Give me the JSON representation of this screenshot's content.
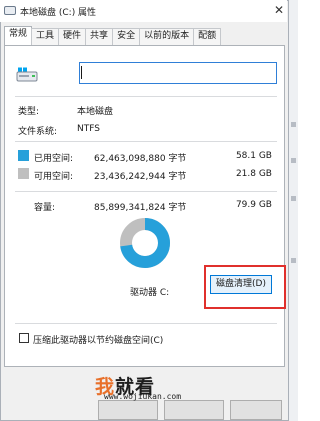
{
  "window": {
    "title": "本地磁盘 (C:) 属性",
    "close_glyph": "✕"
  },
  "tabs": [
    {
      "label": "常规",
      "active": true
    },
    {
      "label": "工具",
      "active": false
    },
    {
      "label": "硬件",
      "active": false
    },
    {
      "label": "共享",
      "active": false
    },
    {
      "label": "安全",
      "active": false
    },
    {
      "label": "以前的版本",
      "active": false
    },
    {
      "label": "配额",
      "active": false
    }
  ],
  "general": {
    "drive_icon": "drive-icon",
    "name_value": "",
    "type_label": "类型:",
    "type_value": "本地磁盘",
    "fs_label": "文件系统:",
    "fs_value": "NTFS"
  },
  "usage": {
    "used": {
      "label": "已用空间:",
      "bytes": "62,463,098,880 字节",
      "gb": "58.1 GB",
      "color": "#26a0da"
    },
    "free": {
      "label": "可用空间:",
      "bytes": "23,436,242,944 字节",
      "gb": "21.8 GB",
      "color": "#bfbfbf"
    },
    "capacity": {
      "label": "容量:",
      "bytes": "85,899,341,824 字节",
      "gb": "79.9 GB"
    },
    "used_fraction": 0.727,
    "drive_label": "驱动器 C:",
    "cleanup_button": "磁盘清理(D)"
  },
  "compress_label": "压缩此驱动器以节约磁盘空间(C)",
  "watermark": {
    "logo_part1": "我",
    "logo_part2": "就看",
    "url": "www.wojiukan.com"
  },
  "colors": {
    "accent": "#0078d7",
    "highlight_box": "#e0302c"
  }
}
